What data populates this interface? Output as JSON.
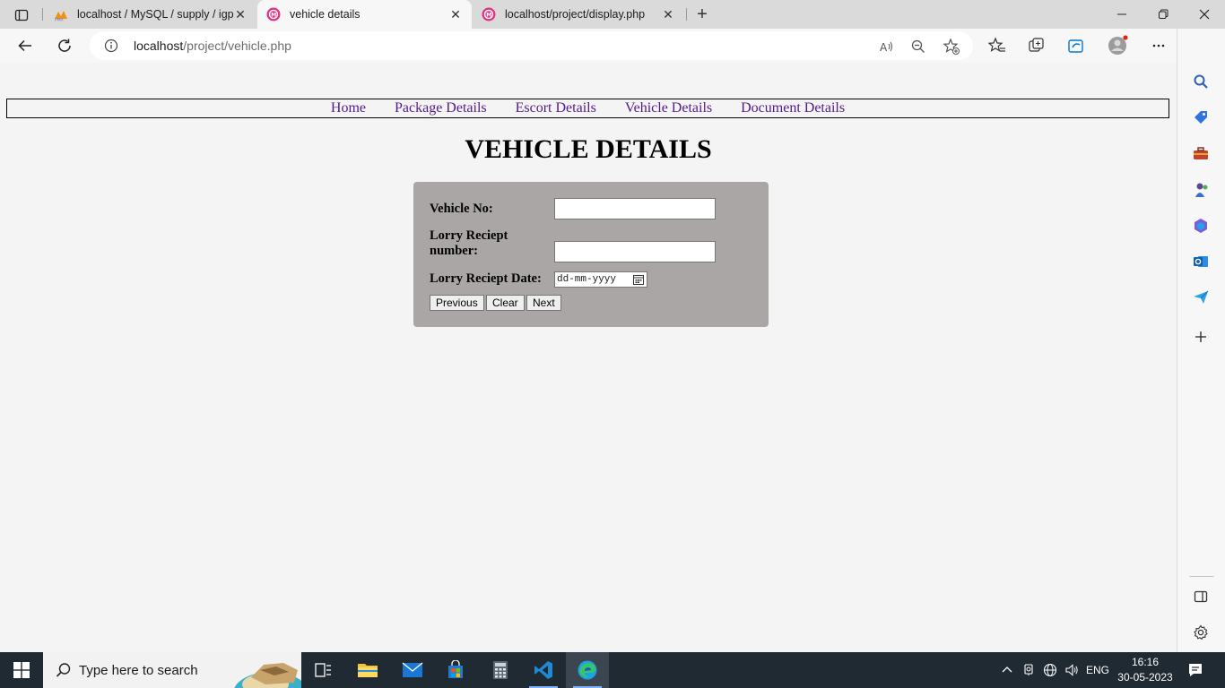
{
  "browser": {
    "tabs": [
      {
        "title": "localhost / MySQL / supply / igp",
        "favicon": "phpmyadmin-icon",
        "active": false
      },
      {
        "title": "vehicle details",
        "favicon": "page-icon",
        "active": true
      },
      {
        "title": "localhost/project/display.php",
        "favicon": "page-icon",
        "active": false
      }
    ],
    "address": {
      "host": "localhost",
      "path": "/project/vehicle.php"
    },
    "accent": "#0078d4"
  },
  "page": {
    "nav": [
      "Home",
      "Package Details",
      "Escort Details",
      "Vehicle Details",
      "Document Details"
    ],
    "title": "VEHICLE DETAILS",
    "form": {
      "vehicle_no_label": "Vehicle No:",
      "lr_number_label": "Lorry Reciept number:",
      "lr_date_label": "Lorry Reciept Date:",
      "vehicle_no_value": "",
      "lr_number_value": "",
      "lr_date_placeholder": "dd-mm-yyyy",
      "buttons": {
        "previous": "Previous",
        "clear": "Clear",
        "next": "Next"
      }
    }
  },
  "taskbar": {
    "search_placeholder": "Type here to search",
    "language": "ENG",
    "time": "16:16",
    "date": "30-05-2023"
  }
}
